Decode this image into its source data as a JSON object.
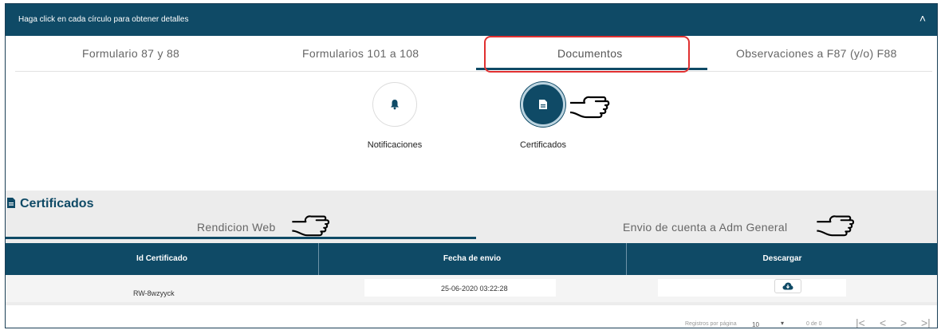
{
  "header": {
    "hint": "Haga click en cada círculo para obtener detalles",
    "collapse_icon": "chevron-up-icon"
  },
  "tabs": [
    "Formulario 87 y 88",
    "Formularios 101 a 108",
    "Documentos",
    "Observaciones a F87 (y/o) F88"
  ],
  "active_tab": "Documentos",
  "categories": [
    {
      "label": "Notificaciones",
      "icon": "bell-icon"
    },
    {
      "label": "Certificados",
      "icon": "document-icon",
      "selected": true
    }
  ],
  "certificados": {
    "title": "Certificados",
    "subtabs": [
      "Rendicion Web",
      "Envio de cuenta a Adm General"
    ],
    "columns": [
      "Id Certificado",
      "Fecha de envio",
      "Descargar"
    ],
    "rows": [
      {
        "id": "RW-8wzyyck",
        "fecha": "25-06-2020 03:22:28"
      }
    ]
  },
  "pagination": {
    "per_page_label": "Registros por página",
    "per_page": "10",
    "range": "0 de 0"
  },
  "colors": {
    "primary": "#0f4a66",
    "highlight": "#e03030"
  }
}
